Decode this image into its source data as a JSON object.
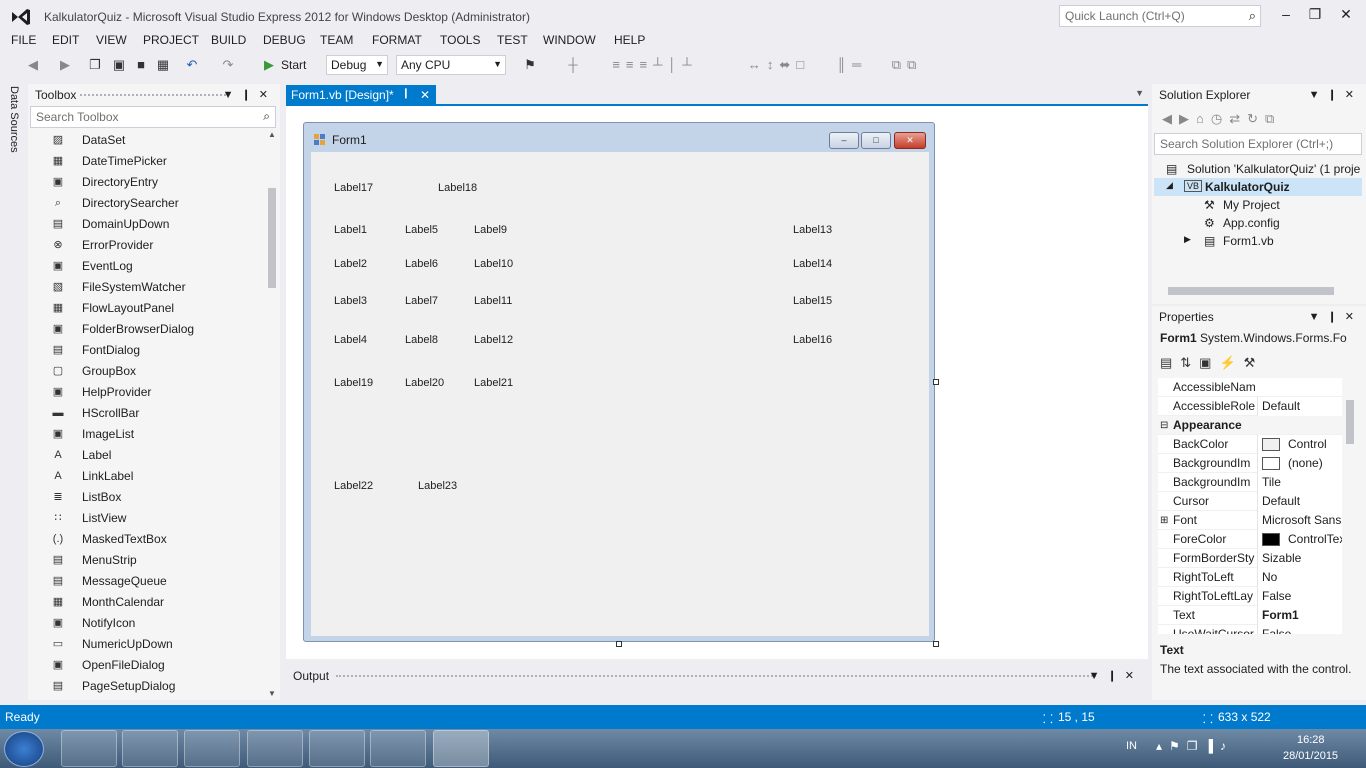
{
  "window": {
    "title": "KalkulatorQuiz - Microsoft Visual Studio Express 2012 for Windows Desktop (Administrator)",
    "quick_launch_placeholder": "Quick Launch (Ctrl+Q)"
  },
  "menu": [
    "FILE",
    "EDIT",
    "VIEW",
    "PROJECT",
    "BUILD",
    "DEBUG",
    "TEAM",
    "FORMAT",
    "TOOLS",
    "TEST",
    "WINDOW",
    "HELP"
  ],
  "toolbar": {
    "start_label": "Start",
    "config": "Debug",
    "platform": "Any CPU"
  },
  "side_tab": "Data Sources",
  "toolbox": {
    "title": "Toolbox",
    "search_placeholder": "Search Toolbox",
    "items": [
      "DataSet",
      "DateTimePicker",
      "DirectoryEntry",
      "DirectorySearcher",
      "DomainUpDown",
      "ErrorProvider",
      "EventLog",
      "FileSystemWatcher",
      "FlowLayoutPanel",
      "FolderBrowserDialog",
      "FontDialog",
      "GroupBox",
      "HelpProvider",
      "HScrollBar",
      "ImageList",
      "Label",
      "LinkLabel",
      "ListBox",
      "ListView",
      "MaskedTextBox",
      "MenuStrip",
      "MessageQueue",
      "MonthCalendar",
      "NotifyIcon",
      "NumericUpDown",
      "OpenFileDialog",
      "PageSetupDialog"
    ]
  },
  "document_tab": {
    "label": "Form1.vb [Design]*"
  },
  "form": {
    "title": "Form1",
    "labels": {
      "l17": "Label17",
      "l18": "Label18",
      "l1": "Label1",
      "l5": "Label5",
      "l9": "Label9",
      "l13": "Label13",
      "l2": "Label2",
      "l6": "Label6",
      "l10": "Label10",
      "l14": "Label14",
      "l3": "Label3",
      "l7": "Label7",
      "l11": "Label11",
      "l15": "Label15",
      "l4": "Label4",
      "l8": "Label8",
      "l12": "Label12",
      "l16": "Label16",
      "l19": "Label19",
      "l20": "Label20",
      "l21": "Label21",
      "l22": "Label22",
      "l23": "Label23"
    }
  },
  "output": {
    "title": "Output"
  },
  "solution_explorer": {
    "title": "Solution Explorer",
    "search_placeholder": "Search Solution Explorer (Ctrl+;)",
    "solution": "Solution 'KalkulatorQuiz' (1 proje",
    "project": "KalkulatorQuiz",
    "items": [
      "My Project",
      "App.config",
      "Form1.vb"
    ]
  },
  "properties": {
    "title": "Properties",
    "object": "Form1",
    "object_type": "System.Windows.Forms.Fo",
    "rows": [
      {
        "name": "AccessibleNam",
        "value": ""
      },
      {
        "name": "AccessibleRole",
        "value": "Default"
      },
      {
        "name": "Appearance",
        "value": "",
        "category": true
      },
      {
        "name": "BackColor",
        "value": "Control",
        "swatch": "#f0f0f0"
      },
      {
        "name": "BackgroundIm",
        "value": "(none)",
        "swatch": "#ffffff"
      },
      {
        "name": "BackgroundIm",
        "value": "Tile"
      },
      {
        "name": "Cursor",
        "value": "Default"
      },
      {
        "name": "Font",
        "value": "Microsoft Sans S"
      },
      {
        "name": "ForeColor",
        "value": "ControlTex",
        "swatch": "#000000"
      },
      {
        "name": "FormBorderSty",
        "value": "Sizable"
      },
      {
        "name": "RightToLeft",
        "value": "No"
      },
      {
        "name": "RightToLeftLay",
        "value": "False"
      },
      {
        "name": "Text",
        "value": "Form1"
      },
      {
        "name": "UseWaitCursor",
        "value": "False"
      }
    ],
    "desc_title": "Text",
    "desc_text": "The text associated with the control."
  },
  "status": {
    "text": "Ready",
    "position": "15 , 15",
    "size": "633 x 522"
  },
  "taskbar": {
    "lang": "IN",
    "time": "16:28",
    "date": "28/01/2015"
  },
  "colors": {
    "accent": "#007acc"
  }
}
